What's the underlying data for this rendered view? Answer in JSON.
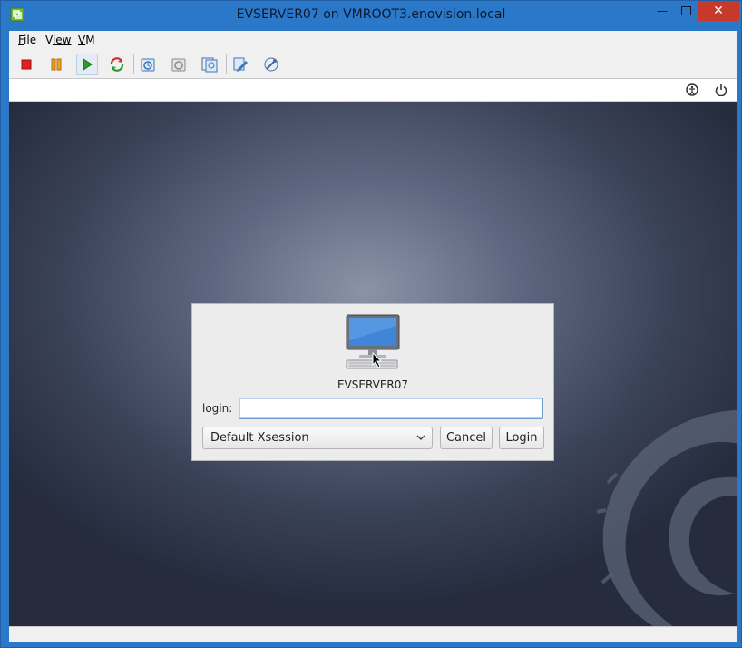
{
  "window": {
    "title": "EVSERVER07 on VMROOT3.enovision.local",
    "app_icon": "vmware-icon",
    "caption_buttons": [
      "minimize-icon",
      "maximize-icon",
      "close-icon"
    ]
  },
  "menu": {
    "items": [
      {
        "label": "File",
        "accel": "F",
        "rest": "ile"
      },
      {
        "label": "View",
        "accel": "V",
        "rest": "iew"
      },
      {
        "label": "VM",
        "accel": "V",
        "rest": "M",
        "prefix": ""
      }
    ]
  },
  "toolbar": {
    "buttons": [
      {
        "icon": "stop-icon",
        "color": "#e02020"
      },
      {
        "icon": "pause-icon",
        "color": "#f0a020"
      },
      {
        "icon": "play-icon",
        "color": "#2a9d2a",
        "active": true
      },
      {
        "icon": "reset-icon",
        "color": "#d03030"
      },
      {
        "icon": "snapshot-take-icon"
      },
      {
        "icon": "snapshot-revert-icon"
      },
      {
        "icon": "snapshot-manager-icon"
      },
      {
        "icon": "edit-settings-icon"
      },
      {
        "icon": "vm-tools-icon"
      }
    ]
  },
  "statusbar": {
    "icons": [
      "accessibility-icon",
      "power-icon"
    ]
  },
  "vm_screen": {
    "background_icon": "debian-swirl-icon",
    "login_dialog": {
      "hostname": "EVSERVER07",
      "login_label": "login:",
      "login_value": "",
      "session_selected": "Default Xsession",
      "cancel_label": "Cancel",
      "login_label_button": "Login"
    }
  },
  "colors": {
    "titlebar": "#2b78c8",
    "close_button": "#c7392b",
    "chrome": "#f0f0f0"
  }
}
